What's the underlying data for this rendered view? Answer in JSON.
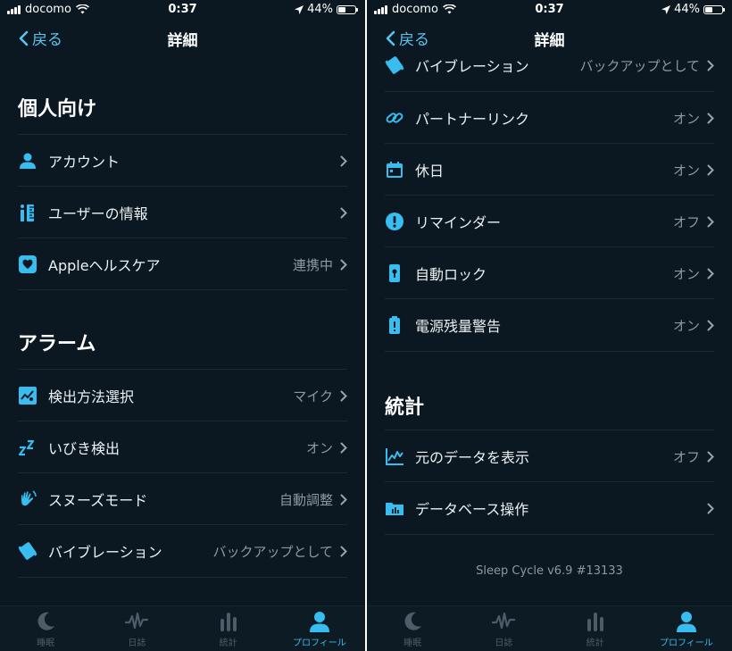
{
  "status_bar": {
    "carrier": "docomo",
    "time": "0:37",
    "battery": "44%",
    "battery_level": 0.44
  },
  "nav": {
    "back_label": "戻る",
    "title": "詳細"
  },
  "left": {
    "sections": [
      {
        "title": "個人向け",
        "rows": [
          {
            "icon": "person-icon",
            "label": "アカウント",
            "value": ""
          },
          {
            "icon": "ruler-icon",
            "label": "ユーザーの情報",
            "value": ""
          },
          {
            "icon": "heart-icon",
            "label": "Appleヘルスケア",
            "value": "連携中"
          }
        ]
      },
      {
        "title": "アラーム",
        "rows": [
          {
            "icon": "detection-icon",
            "label": "検出方法選択",
            "value": "マイク"
          },
          {
            "icon": "snore-icon",
            "label": "いびき検出",
            "value": "オン"
          },
          {
            "icon": "hand-icon",
            "label": "スヌーズモード",
            "value": "自動調整"
          },
          {
            "icon": "vibration-icon",
            "label": "バイブレーション",
            "value": "バックアップとして"
          }
        ]
      }
    ]
  },
  "right": {
    "rows_top": [
      {
        "icon": "vibration-icon",
        "label": "バイブレーション",
        "value": "バックアップとして"
      },
      {
        "icon": "link-icon",
        "label": "パートナーリンク",
        "value": "オン"
      },
      {
        "icon": "calendar-icon",
        "label": "休日",
        "value": "オン"
      },
      {
        "icon": "exclamation-icon",
        "label": "リマインダー",
        "value": "オフ"
      },
      {
        "icon": "phone-lock-icon",
        "label": "自動ロック",
        "value": "オン"
      },
      {
        "icon": "battery-warning-icon",
        "label": "電源残量警告",
        "value": "オン"
      }
    ],
    "stats_section": {
      "title": "統計",
      "rows": [
        {
          "icon": "line-chart-icon",
          "label": "元のデータを表示",
          "value": "オフ"
        },
        {
          "icon": "folder-chart-icon",
          "label": "データベース操作",
          "value": ""
        }
      ]
    },
    "version": "Sleep Cycle v6.9 #13133"
  },
  "tabs": [
    {
      "icon": "moon-icon",
      "label": "睡眠",
      "active": false
    },
    {
      "icon": "wave-icon",
      "label": "日誌",
      "active": false
    },
    {
      "icon": "bars-icon",
      "label": "統計",
      "active": false
    },
    {
      "icon": "profile-icon",
      "label": "プロフィール",
      "active": true
    }
  ],
  "colors": {
    "background": "#0b1821",
    "accent": "#38bdf0",
    "muted": "#8d989f",
    "divider": "#1c2a34"
  }
}
